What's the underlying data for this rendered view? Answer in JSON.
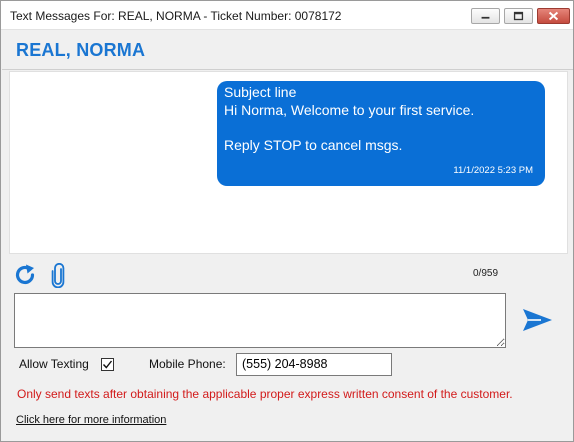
{
  "window": {
    "title": "Text Messages For: REAL, NORMA - Ticket Number: 0078172",
    "controls": {
      "minimize": "minimize-icon",
      "maximize": "maximize-icon",
      "close": "close-icon"
    }
  },
  "header": {
    "customer_name": "REAL, NORMA"
  },
  "thread": {
    "messages": [
      {
        "lines": [
          "Subject line",
          "Hi Norma, Welcome to your first service.",
          "",
          "Reply STOP to cancel msgs."
        ],
        "timestamp": "11/1/2022 5:23 PM",
        "bubble_color": "#0a6fd6"
      }
    ]
  },
  "toolbar": {
    "refresh_icon": "refresh-icon",
    "attach_icon": "paperclip-icon",
    "char_count": "0/959"
  },
  "composer": {
    "value": "",
    "send_icon": "send-icon"
  },
  "options": {
    "allow_texting_label": "Allow Texting",
    "allow_texting_checked": true,
    "mobile_phone_label": "Mobile Phone:",
    "mobile_phone_value": "(555) 204-8988"
  },
  "warning": "Only send texts after obtaining the applicable proper express written consent of the customer.",
  "info_link": "Click here for more information",
  "colors": {
    "accent": "#1a76d2",
    "warning": "#d21a1a",
    "bubble": "#0a6fd6"
  }
}
